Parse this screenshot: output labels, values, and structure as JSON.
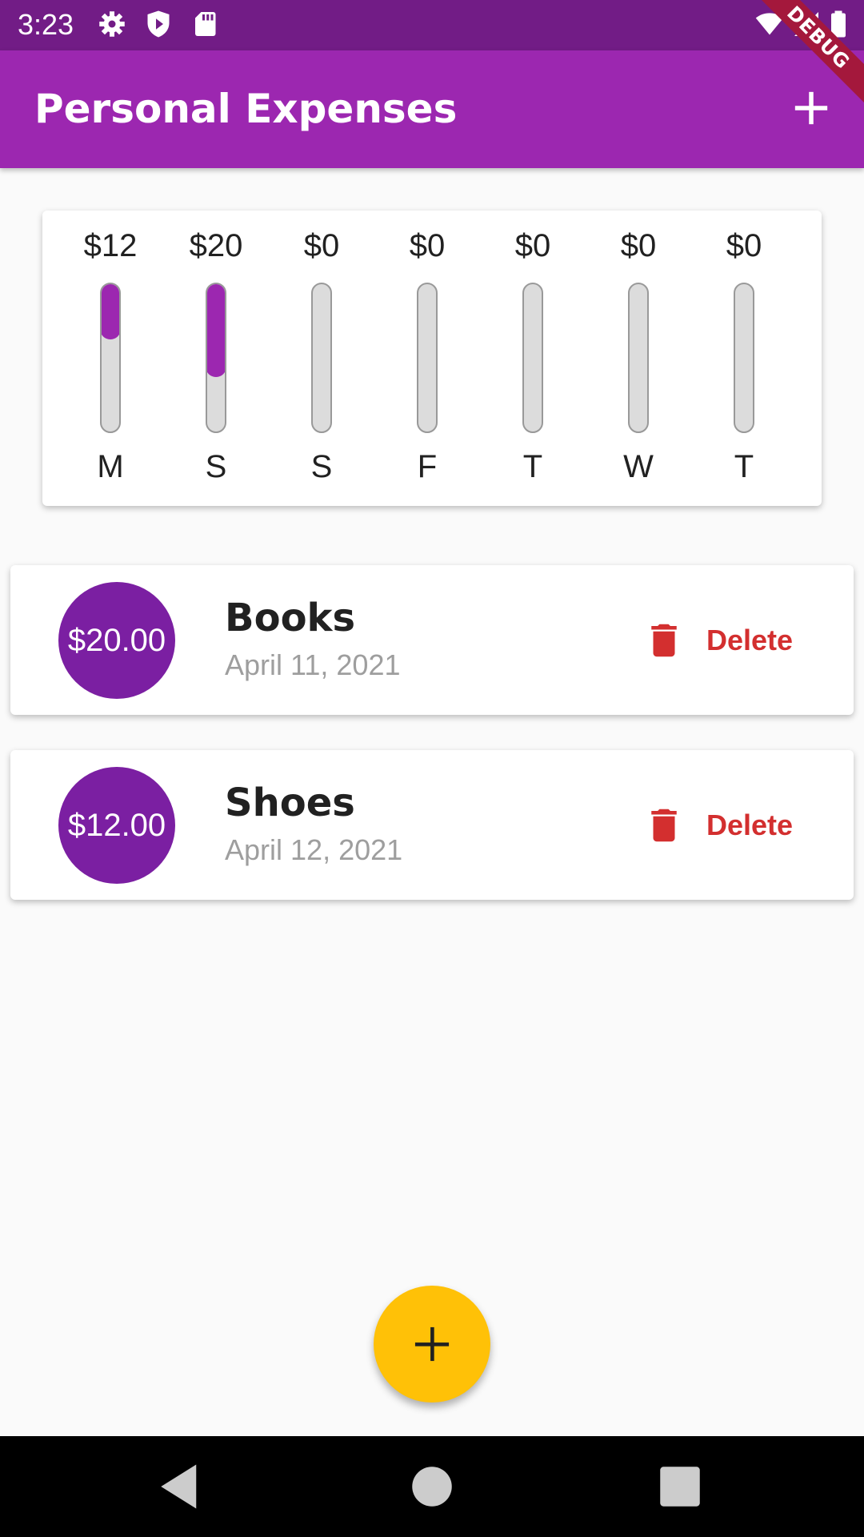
{
  "status_bar": {
    "time": "3:23",
    "icons": [
      "gear-icon",
      "shield-play-icon",
      "sd-card-icon",
      "wifi-icon",
      "cell-signal-icon",
      "battery-icon"
    ]
  },
  "app_bar": {
    "title": "Personal Expenses",
    "add_icon": "plus-icon",
    "debug_label": "DEBUG",
    "color": "#9c27b0"
  },
  "chart": {
    "bars": [
      {
        "amount": "$12",
        "day": "M",
        "fraction": 0.375
      },
      {
        "amount": "$20",
        "day": "S",
        "fraction": 0.625
      },
      {
        "amount": "$0",
        "day": "S",
        "fraction": 0
      },
      {
        "amount": "$0",
        "day": "F",
        "fraction": 0
      },
      {
        "amount": "$0",
        "day": "T",
        "fraction": 0
      },
      {
        "amount": "$0",
        "day": "W",
        "fraction": 0
      },
      {
        "amount": "$0",
        "day": "T",
        "fraction": 0
      }
    ],
    "fill_color": "#9c27b0",
    "track_color": "#dcdcdc"
  },
  "transactions": [
    {
      "amount": "$20.00",
      "title": "Books",
      "date": "April 11, 2021",
      "delete_label": "Delete"
    },
    {
      "amount": "$12.00",
      "title": "Shoes",
      "date": "April 12, 2021",
      "delete_label": "Delete"
    }
  ],
  "fab": {
    "icon": "plus-icon",
    "color": "#ffc107"
  },
  "nav_bar": {
    "icons": [
      "back-icon",
      "home-icon",
      "recents-icon"
    ]
  }
}
